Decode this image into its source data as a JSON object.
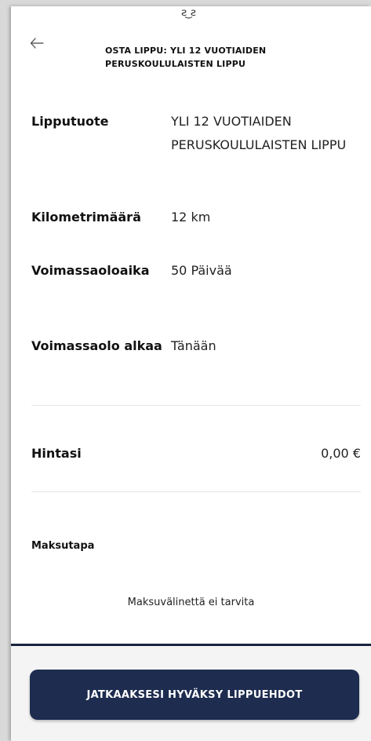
{
  "header": {
    "title": "OSTA LIPPU: YLI 12 VUOTIAIDEN PERUSKOULULAISTEN LIPPU"
  },
  "details": [
    {
      "label": "Lipputuote",
      "value": "YLI 12 VUOTIAIDEN PERUSKOULULAISTEN LIPPU"
    },
    {
      "label": "Kilometrimäärä",
      "value": "12 km"
    },
    {
      "label": "Voimassaoloaika",
      "value": "50 Päivää"
    },
    {
      "label": "Voimassaolo alkaa",
      "value": "Tänään"
    }
  ],
  "price": {
    "label": "Hintasi",
    "value": "0,00 €"
  },
  "payment": {
    "title": "Maksutapa",
    "note": "Maksuvälinettä ei tarvita"
  },
  "cta": {
    "label": "JATKAAKSESI HYVÄKSY LIPPUEHDOT"
  },
  "icons": {
    "back": "arrow-left-icon"
  },
  "colors": {
    "primary": "#1d2c4f",
    "background": "#ffffff"
  }
}
